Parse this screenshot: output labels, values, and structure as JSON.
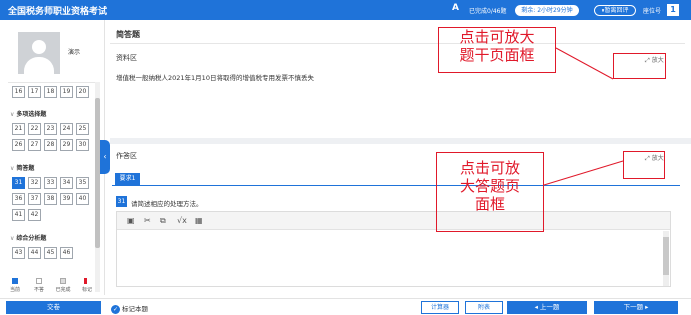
{
  "header": {
    "title": "全国税务师职业资格考试",
    "font_icon": "A",
    "answered": "已完成0/46题",
    "timer": "剩余: 2小时29分钟",
    "pause": "暂离回评",
    "seat_label": "座位号",
    "seat_number": "1"
  },
  "sidebar": {
    "user_name": "演示",
    "rows": [
      [
        "16",
        "17",
        "18",
        "19",
        "20"
      ],
      [
        "21",
        "22",
        "23",
        "24",
        "25"
      ],
      [
        "26",
        "27",
        "28",
        "29",
        "30"
      ],
      [
        "31",
        "32",
        "33",
        "34",
        "35"
      ],
      [
        "36",
        "37",
        "38",
        "39",
        "40"
      ],
      [
        "41",
        "42"
      ],
      [
        "43",
        "44",
        "45",
        "46"
      ]
    ],
    "sections": {
      "multi": "多项选择题",
      "short": "简答题",
      "analysis": "综合分析题"
    },
    "legend": {
      "current": "当前",
      "unanswered": "不答",
      "done": "已完成",
      "marked": "标记"
    },
    "colors": {
      "current": "#1f73d9"
    }
  },
  "material": {
    "type_title": "简答题",
    "label": "资料区",
    "expand": "放大",
    "text": "增值税一般纳税人2021年1月10日将取得的增值税专用发票不慎丢失"
  },
  "answer": {
    "label": "作答区",
    "expand": "放大",
    "tab": "要求1",
    "qnum": "31",
    "question": "请简述相应的处理方法。"
  },
  "footer": {
    "submit": "交卷",
    "mark": "标记本题",
    "calculator": "计算器",
    "attachment": "附表",
    "prev": "上一题",
    "next": "下一题"
  },
  "annotations": {
    "top": "点击可放大\n题干页面框",
    "bottom": "点击可放\n大答题页\n面框",
    "color": "#e0192a"
  }
}
